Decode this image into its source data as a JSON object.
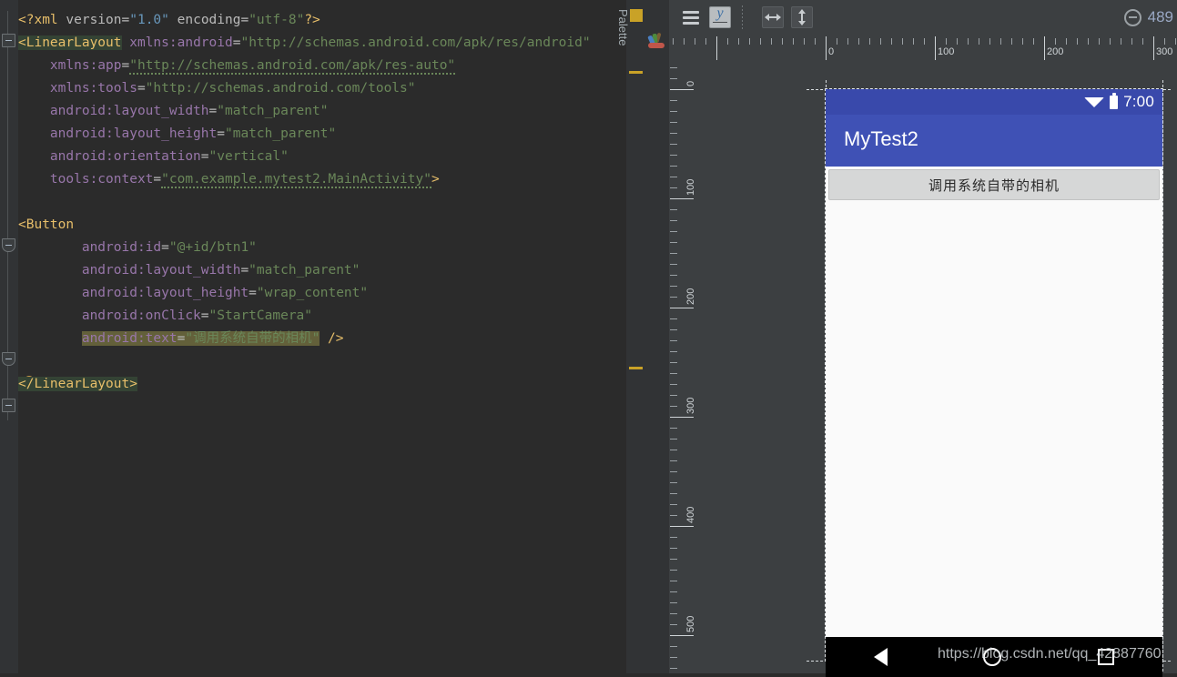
{
  "editor": {
    "lines": [
      [
        {
          "t": "<?xml ",
          "c": "t-proc"
        },
        {
          "t": "version",
          "c": "t-attr"
        },
        {
          "t": "=",
          "c": "t-eq"
        },
        {
          "t": "\"1.0\"",
          "c": "t-num"
        },
        {
          "t": " ",
          "c": "t-punct"
        },
        {
          "t": "encoding",
          "c": "t-attr"
        },
        {
          "t": "=",
          "c": "t-eq"
        },
        {
          "t": "\"utf-8\"",
          "c": "t-val"
        },
        {
          "t": "?>",
          "c": "t-proc"
        }
      ],
      [
        {
          "t": "<LinearLayout",
          "c": "t-tag hl-tag"
        },
        {
          "t": " ",
          "c": "t-punct"
        },
        {
          "t": "xmlns:android",
          "c": "t-ns"
        },
        {
          "t": "=",
          "c": "t-eq"
        },
        {
          "t": "\"http://schemas.android.com/apk/res/android\"",
          "c": "t-val"
        }
      ],
      [
        {
          "t": "    xmlns:app",
          "c": "t-ns",
          "indent": 4
        },
        {
          "t": "=",
          "c": "t-eq"
        },
        {
          "t": "\"http://schemas.android.com/apk/res-auto\"",
          "c": "t-val squig"
        }
      ],
      [
        {
          "t": "    xmlns:tools",
          "c": "t-ns"
        },
        {
          "t": "=",
          "c": "t-eq"
        },
        {
          "t": "\"http://schemas.android.com/tools\"",
          "c": "t-val"
        }
      ],
      [
        {
          "t": "    android:layout_width",
          "c": "t-ns"
        },
        {
          "t": "=",
          "c": "t-eq"
        },
        {
          "t": "\"match_parent\"",
          "c": "t-val"
        }
      ],
      [
        {
          "t": "    android:layout_height",
          "c": "t-ns"
        },
        {
          "t": "=",
          "c": "t-eq"
        },
        {
          "t": "\"match_parent\"",
          "c": "t-val"
        }
      ],
      [
        {
          "t": "    android:orientation",
          "c": "t-ns"
        },
        {
          "t": "=",
          "c": "t-eq"
        },
        {
          "t": "\"vertical\"",
          "c": "t-val"
        }
      ],
      [
        {
          "t": "    tools:context",
          "c": "t-ns"
        },
        {
          "t": "=",
          "c": "t-eq"
        },
        {
          "t": "\"com.example.mytest2.MainActivity\"",
          "c": "t-val squig"
        },
        {
          "t": ">",
          "c": "t-tag"
        }
      ],
      [],
      [
        {
          "t": "<Button",
          "c": "t-tag"
        }
      ],
      [
        {
          "t": "        android:id",
          "c": "t-ns"
        },
        {
          "t": "=",
          "c": "t-eq"
        },
        {
          "t": "\"@+id/btn1\"",
          "c": "t-val"
        }
      ],
      [
        {
          "t": "        android:layout_width",
          "c": "t-ns"
        },
        {
          "t": "=",
          "c": "t-eq"
        },
        {
          "t": "\"match_parent\"",
          "c": "t-val"
        }
      ],
      [
        {
          "t": "        android:layout_height",
          "c": "t-ns"
        },
        {
          "t": "=",
          "c": "t-eq"
        },
        {
          "t": "\"wrap_content\"",
          "c": "t-val"
        }
      ],
      [
        {
          "t": "        android:onClick",
          "c": "t-ns"
        },
        {
          "t": "=",
          "c": "t-eq"
        },
        {
          "t": "\"StartCamera\"",
          "c": "t-val"
        }
      ],
      [
        {
          "t": "        ",
          "c": "t-punct"
        },
        {
          "t": "android:text",
          "c": "t-ns hl-sel"
        },
        {
          "t": "=",
          "c": "t-eq hl-sel"
        },
        {
          "t": "\"调用系统自带的相机\"",
          "c": "t-val hl-sel"
        },
        {
          "t": " />",
          "c": "t-tag"
        }
      ],
      [],
      [
        {
          "t": "</LinearLayout>",
          "c": "t-tag hl-tag"
        }
      ]
    ]
  },
  "toolbar": {
    "layout_menu_label": "layout-variants-menu",
    "blueprint_label": "design-blueprint-toggle",
    "fit_horizontal_label": "match-width-button",
    "fit_vertical_label": "match-height-button",
    "zoom_out_label": "zoom-out-button",
    "zoom_percent": "489"
  },
  "palette": {
    "label": "Palette"
  },
  "rulers": {
    "horizontal": [
      "0",
      "100",
      "200",
      "300"
    ],
    "vertical": [
      "0",
      "100",
      "200",
      "300",
      "400",
      "500"
    ]
  },
  "device": {
    "statusbar": {
      "time": "7:00",
      "wifi_icon": "wifi-icon",
      "battery_icon": "battery-icon"
    },
    "app_title": "MyTest2",
    "button_text": "调用系统自带的相机",
    "navbar": {
      "back_icon": "back-triangle-icon",
      "home_icon": "home-circle-icon",
      "recents_icon": "recents-square-icon"
    }
  },
  "watermark": "https://blog.csdn.net/qq_42887760",
  "colors": {
    "editor_bg": "#2b2b2b",
    "panel_bg": "#3c3f41",
    "appbar": "#3f51b5",
    "statusbar": "#3949ab",
    "accent_yellow": "#c9a227",
    "tag": "#e8bf6a",
    "string": "#6a8759",
    "attr": "#9876aa"
  }
}
